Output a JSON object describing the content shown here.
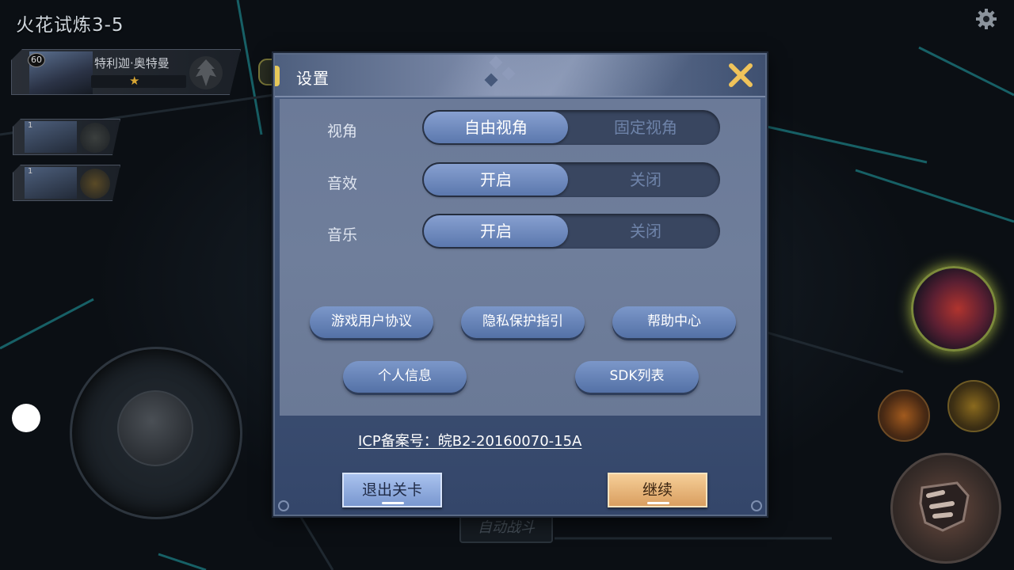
{
  "stage": {
    "title": "火花试炼3-5"
  },
  "hero": {
    "level": "60",
    "name": "特利迦·奥特曼",
    "star": "★"
  },
  "team": [
    {
      "level": "1"
    },
    {
      "level": "1"
    }
  ],
  "auto_battle_label": "自动战斗",
  "settings": {
    "title": "设置",
    "rows": [
      {
        "label": "视角",
        "on": "自由视角",
        "off": "固定视角"
      },
      {
        "label": "音效",
        "on": "开启",
        "off": "关闭"
      },
      {
        "label": "音乐",
        "on": "开启",
        "off": "关闭"
      }
    ],
    "links": {
      "user_agreement": "游戏用户协议",
      "privacy": "隐私保护指引",
      "help": "帮助中心",
      "personal_info": "个人信息",
      "sdk_list": "SDK列表"
    },
    "icp": "ICP备案号：皖B2-20160070-15A",
    "exit_label": "退出关卡",
    "continue_label": "继续"
  },
  "colors": {
    "modal": "#3e5173",
    "toggle_on": "#6f8bc0",
    "continue": "#e8b57c",
    "exit": "#8fabdf",
    "close": "#f0c35a"
  },
  "icons": [
    "gear-icon",
    "close-icon",
    "star-icon"
  ]
}
